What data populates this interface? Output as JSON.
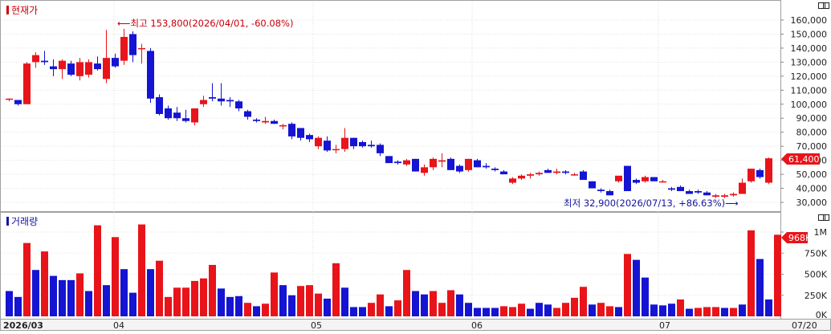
{
  "chart_data": [
    {
      "type": "candlestick",
      "title": "현재가",
      "date_range": {
        "start": "2026/03",
        "end": "07/20"
      },
      "x_tick_labels": [
        "2026/03",
        "04",
        "05",
        "06",
        "07",
        "07/20"
      ],
      "y_tick_labels": [
        "30,000",
        "40,000",
        "50,000",
        "60,000",
        "70,000",
        "80,000",
        "90,000",
        "100,000",
        "110,000",
        "120,000",
        "130,000",
        "140,000",
        "150,000",
        "160,000"
      ],
      "ylim": [
        25000,
        165000
      ],
      "current_price_label": "61,400",
      "annotations": {
        "high": "최고 153,800(2026/04/01, -60.08%)",
        "low": "최저 32,900(2026/07/13, +86.63%)"
      },
      "colors": {
        "up": "#e8141a",
        "down": "#1414d2",
        "text_red": "#c8000a",
        "text_blue": "#1414a0"
      },
      "candles": [
        [
          104000,
          104000,
          102000,
          104000
        ],
        [
          103000,
          103000,
          99000,
          100000
        ],
        [
          100000,
          130000,
          100000,
          129000
        ],
        [
          130000,
          137000,
          126000,
          135000
        ],
        [
          131000,
          138000,
          128000,
          130000
        ],
        [
          127000,
          132000,
          120000,
          125000
        ],
        [
          125000,
          132000,
          118000,
          131000
        ],
        [
          129000,
          131000,
          120000,
          121000
        ],
        [
          120000,
          133000,
          117000,
          130000
        ],
        [
          121000,
          132000,
          119000,
          130000
        ],
        [
          129000,
          134000,
          124000,
          125000
        ],
        [
          118000,
          153000,
          115000,
          133000
        ],
        [
          133000,
          136000,
          126000,
          127000
        ],
        [
          131000,
          153800,
          128000,
          148000
        ],
        [
          150000,
          152000,
          130000,
          135000
        ],
        [
          140000,
          143000,
          129000,
          140000
        ],
        [
          138000,
          140000,
          101000,
          104000
        ],
        [
          105000,
          107000,
          92000,
          93000
        ],
        [
          97000,
          99000,
          89000,
          90000
        ],
        [
          94000,
          98000,
          88000,
          90000
        ],
        [
          90000,
          96000,
          87000,
          88000
        ],
        [
          87000,
          97000,
          85000,
          97000
        ],
        [
          100000,
          106000,
          98000,
          103000
        ],
        [
          105000,
          115000,
          102000,
          104000
        ],
        [
          104000,
          115000,
          99000,
          102000
        ],
        [
          103000,
          105000,
          98000,
          102000
        ],
        [
          102000,
          103000,
          95000,
          97000
        ],
        [
          95000,
          96000,
          89000,
          91000
        ],
        [
          89000,
          90000,
          87000,
          88000
        ],
        [
          87000,
          91000,
          86000,
          88000
        ],
        [
          88000,
          89000,
          86000,
          86000
        ],
        [
          85000,
          86000,
          82000,
          85000
        ],
        [
          86000,
          87000,
          75000,
          77000
        ],
        [
          83000,
          83000,
          74000,
          76000
        ],
        [
          78000,
          79000,
          73000,
          75000
        ],
        [
          70000,
          77000,
          68000,
          76000
        ],
        [
          74000,
          77000,
          66000,
          67000
        ],
        [
          68000,
          71000,
          65000,
          68000
        ],
        [
          68000,
          83000,
          66000,
          76000
        ],
        [
          76000,
          76000,
          68000,
          70000
        ],
        [
          73000,
          74000,
          69000,
          70000
        ],
        [
          71000,
          74000,
          69000,
          70000
        ],
        [
          71000,
          72000,
          63000,
          65000
        ],
        [
          63000,
          63000,
          58000,
          58000
        ],
        [
          59000,
          60000,
          57000,
          58000
        ],
        [
          57000,
          61000,
          56000,
          60000
        ],
        [
          61000,
          61000,
          52000,
          52000
        ],
        [
          51000,
          57000,
          49000,
          55000
        ],
        [
          55000,
          62000,
          53000,
          61000
        ],
        [
          59000,
          65000,
          55000,
          60000
        ],
        [
          61000,
          62000,
          53000,
          53000
        ],
        [
          56000,
          57000,
          51000,
          52000
        ],
        [
          53000,
          61000,
          52000,
          61000
        ],
        [
          60000,
          61000,
          55000,
          55000
        ],
        [
          56000,
          58000,
          54000,
          55000
        ],
        [
          54000,
          55000,
          52000,
          53000
        ],
        [
          52000,
          53000,
          50000,
          50000
        ],
        [
          44000,
          48000,
          43000,
          47000
        ],
        [
          47000,
          50000,
          46000,
          49000
        ],
        [
          49000,
          51000,
          47000,
          50000
        ],
        [
          50000,
          52000,
          49000,
          51000
        ],
        [
          53000,
          54000,
          51000,
          51000
        ],
        [
          51000,
          54000,
          50000,
          52000
        ],
        [
          52000,
          53000,
          50000,
          51000
        ],
        [
          50000,
          51000,
          49000,
          50000
        ],
        [
          52000,
          53000,
          46000,
          46000
        ],
        [
          45000,
          45000,
          40000,
          40000
        ],
        [
          39000,
          40000,
          37000,
          38000
        ],
        [
          38000,
          39000,
          35000,
          35000
        ],
        [
          45000,
          49000,
          44000,
          49000
        ],
        [
          56000,
          56000,
          38000,
          38000
        ],
        [
          46000,
          47000,
          43000,
          44000
        ],
        [
          45000,
          49000,
          44000,
          48000
        ],
        [
          48000,
          48000,
          45000,
          45000
        ],
        [
          45000,
          46000,
          44000,
          45000
        ],
        [
          40000,
          41000,
          38000,
          39000
        ],
        [
          41000,
          42000,
          38000,
          38000
        ],
        [
          38000,
          39000,
          36000,
          36000
        ],
        [
          38000,
          39000,
          36000,
          37000
        ],
        [
          37000,
          38000,
          35000,
          35000
        ],
        [
          34000,
          36000,
          33000,
          35000
        ],
        [
          34000,
          36000,
          32900,
          35000
        ],
        [
          35000,
          37000,
          34000,
          36000
        ],
        [
          36000,
          47000,
          36000,
          44000
        ],
        [
          45000,
          54000,
          44000,
          54000
        ],
        [
          53000,
          54000,
          47000,
          48000
        ],
        [
          44000,
          62000,
          43000,
          61400
        ]
      ]
    },
    {
      "type": "bar",
      "title": "거래량",
      "yticks": [
        "250K",
        "500K",
        "750K",
        "1M"
      ],
      "ylim": [
        0,
        1100000
      ],
      "current_volume_label": "968K",
      "volumes": [
        {
          "v": 300000,
          "up": false
        },
        {
          "v": 230000,
          "up": false
        },
        {
          "v": 870000,
          "up": true
        },
        {
          "v": 550000,
          "up": false
        },
        {
          "v": 770000,
          "up": true
        },
        {
          "v": 480000,
          "up": false
        },
        {
          "v": 430000,
          "up": false
        },
        {
          "v": 430000,
          "up": false
        },
        {
          "v": 510000,
          "up": true
        },
        {
          "v": 300000,
          "up": false
        },
        {
          "v": 1080000,
          "up": true
        },
        {
          "v": 370000,
          "up": false
        },
        {
          "v": 940000,
          "up": true
        },
        {
          "v": 560000,
          "up": false
        },
        {
          "v": 280000,
          "up": false
        },
        {
          "v": 1090000,
          "up": true
        },
        {
          "v": 560000,
          "up": false
        },
        {
          "v": 660000,
          "up": true
        },
        {
          "v": 230000,
          "up": true
        },
        {
          "v": 340000,
          "up": true
        },
        {
          "v": 340000,
          "up": true
        },
        {
          "v": 420000,
          "up": true
        },
        {
          "v": 450000,
          "up": true
        },
        {
          "v": 610000,
          "up": true
        },
        {
          "v": 330000,
          "up": false
        },
        {
          "v": 230000,
          "up": false
        },
        {
          "v": 240000,
          "up": false
        },
        {
          "v": 160000,
          "up": true
        },
        {
          "v": 120000,
          "up": false
        },
        {
          "v": 150000,
          "up": true
        },
        {
          "v": 520000,
          "up": true
        },
        {
          "v": 370000,
          "up": false
        },
        {
          "v": 250000,
          "up": false
        },
        {
          "v": 360000,
          "up": true
        },
        {
          "v": 370000,
          "up": true
        },
        {
          "v": 270000,
          "up": true
        },
        {
          "v": 210000,
          "up": false
        },
        {
          "v": 630000,
          "up": true
        },
        {
          "v": 340000,
          "up": false
        },
        {
          "v": 110000,
          "up": false
        },
        {
          "v": 110000,
          "up": false
        },
        {
          "v": 160000,
          "up": true
        },
        {
          "v": 260000,
          "up": true
        },
        {
          "v": 120000,
          "up": false
        },
        {
          "v": 190000,
          "up": true
        },
        {
          "v": 550000,
          "up": true
        },
        {
          "v": 300000,
          "up": false
        },
        {
          "v": 260000,
          "up": false
        },
        {
          "v": 300000,
          "up": true
        },
        {
          "v": 160000,
          "up": true
        },
        {
          "v": 310000,
          "up": true
        },
        {
          "v": 260000,
          "up": false
        },
        {
          "v": 160000,
          "up": false
        },
        {
          "v": 100000,
          "up": false
        },
        {
          "v": 100000,
          "up": false
        },
        {
          "v": 100000,
          "up": false
        },
        {
          "v": 120000,
          "up": true
        },
        {
          "v": 110000,
          "up": true
        },
        {
          "v": 150000,
          "up": true
        },
        {
          "v": 90000,
          "up": false
        },
        {
          "v": 160000,
          "up": false
        },
        {
          "v": 140000,
          "up": false
        },
        {
          "v": 100000,
          "up": true
        },
        {
          "v": 160000,
          "up": true
        },
        {
          "v": 220000,
          "up": true
        },
        {
          "v": 350000,
          "up": true
        },
        {
          "v": 140000,
          "up": false
        },
        {
          "v": 160000,
          "up": true
        },
        {
          "v": 120000,
          "up": true
        },
        {
          "v": 110000,
          "up": false
        },
        {
          "v": 740000,
          "up": true
        },
        {
          "v": 670000,
          "up": false
        },
        {
          "v": 460000,
          "up": false
        },
        {
          "v": 140000,
          "up": false
        },
        {
          "v": 130000,
          "up": false
        },
        {
          "v": 150000,
          "up": false
        },
        {
          "v": 200000,
          "up": true
        },
        {
          "v": 90000,
          "up": false
        },
        {
          "v": 100000,
          "up": true
        },
        {
          "v": 110000,
          "up": true
        },
        {
          "v": 110000,
          "up": true
        },
        {
          "v": 100000,
          "up": false
        },
        {
          "v": 100000,
          "up": true
        },
        {
          "v": 140000,
          "up": false
        },
        {
          "v": 1020000,
          "up": true
        },
        {
          "v": 680000,
          "up": false
        },
        {
          "v": 200000,
          "up": false
        },
        {
          "v": 968000,
          "up": true
        }
      ]
    }
  ]
}
